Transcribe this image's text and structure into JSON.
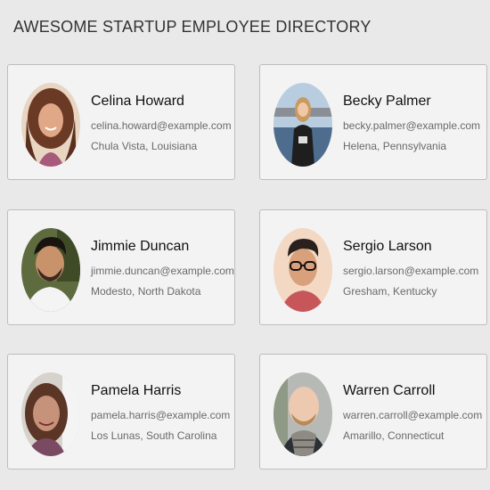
{
  "header": {
    "title": "AWESOME STARTUP EMPLOYEE DIRECTORY"
  },
  "employees": [
    {
      "name": "Celina Howard",
      "email": "celina.howard@example.com",
      "location": "Chula Vista, Louisiana",
      "photo_icon": "woman-curly-hair-photo"
    },
    {
      "name": "Becky Palmer",
      "email": "becky.palmer@example.com",
      "location": "Helena, Pennsylvania",
      "photo_icon": "woman-waterfront-photo"
    },
    {
      "name": "Jimmie Duncan",
      "email": "jimmie.duncan@example.com",
      "location": "Modesto, North Dakota",
      "photo_icon": "man-beard-photo"
    },
    {
      "name": "Sergio Larson",
      "email": "sergio.larson@example.com",
      "location": "Gresham, Kentucky",
      "photo_icon": "man-glasses-photo"
    },
    {
      "name": "Pamela Harris",
      "email": "pamela.harris@example.com",
      "location": "Los Lunas, South Carolina",
      "photo_icon": "woman-selfie-photo"
    },
    {
      "name": "Warren Carroll",
      "email": "warren.carroll@example.com",
      "location": "Amarillo, Connecticut",
      "photo_icon": "man-bald-scarf-photo"
    }
  ],
  "colors": {
    "background": "#e9e9e9",
    "card_background": "#f3f3f3",
    "card_border": "#bdbdbd",
    "name_text": "#111111",
    "detail_text": "#6a6a6a"
  }
}
